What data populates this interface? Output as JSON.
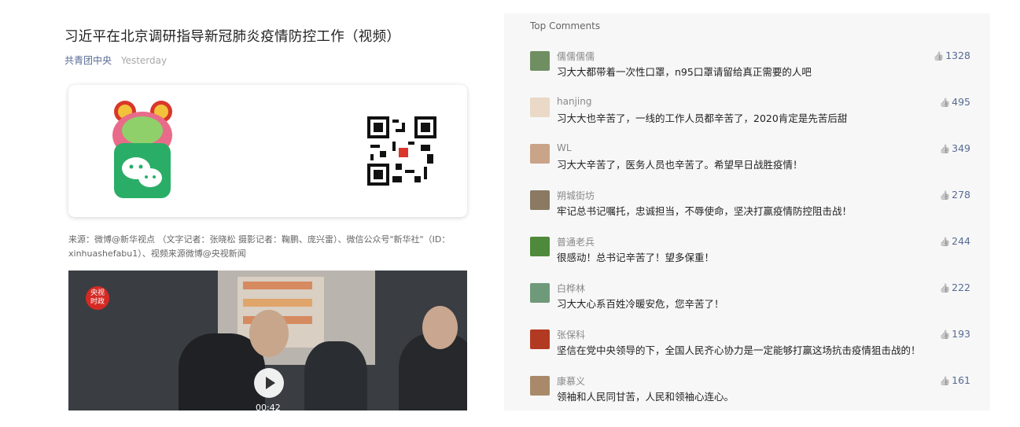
{
  "article": {
    "title": "习近平在北京调研指导新冠肺炎疫情防控工作（视频）",
    "author": "共青团中央",
    "time": "Yesterday",
    "source_line1": "来源：微博@新华视点 （文字记者：张晓松 摄影记者：鞠鹏、庞兴雷）、微信公众号\"新华社\"（ID：",
    "source_line2": "xinhuashefabu1）、视频来源微博@央视新闻",
    "video": {
      "logo_text": "央视\n时政",
      "duration": "00:42"
    }
  },
  "comments": {
    "header": "Top Comments",
    "items": [
      {
        "name": "儒儒儒儒",
        "text": "习大大都带着一次性口罩，n95口罩请留给真正需要的人吧",
        "likes": "1328",
        "avatar_color": "#6f8f62"
      },
      {
        "name": "hanjing",
        "text": "习大大也辛苦了，一线的工作人员都辛苦了，2020肯定是先苦后甜",
        "likes": "495",
        "avatar_color": "#e9d9c6"
      },
      {
        "name": "WL",
        "text": "习大大辛苦了，医务人员也辛苦了。希望早日战胜疫情！",
        "likes": "349",
        "avatar_color": "#c9a489"
      },
      {
        "name": "朔城街坊",
        "text": "牢记总书记嘱托，忠诚担当，不辱使命，坚决打赢疫情防控阻击战！",
        "likes": "278",
        "avatar_color": "#8a7a62"
      },
      {
        "name": "普通老兵",
        "text": "很感动！总书记辛苦了！望多保重！",
        "likes": "244",
        "avatar_color": "#4f8a3c"
      },
      {
        "name": "白桦林",
        "text": "习大大心系百姓冷暖安危，您辛苦了！",
        "likes": "222",
        "avatar_color": "#6f9a7a"
      },
      {
        "name": "张保科",
        "text": "坚信在党中央领导的下，全国人民齐心协力是一定能够打赢这场抗击疫情狙击战的！",
        "likes": "193",
        "avatar_color": "#b33a22"
      },
      {
        "name": "康慕义",
        "text": "领袖和人民同甘苦，人民和领袖心连心。",
        "likes": "161",
        "avatar_color": "#a88a6a"
      }
    ]
  },
  "colors": {
    "link": "#576b95",
    "panel_bg": "#f7f7f7",
    "wechat_green": "#2aae67"
  }
}
